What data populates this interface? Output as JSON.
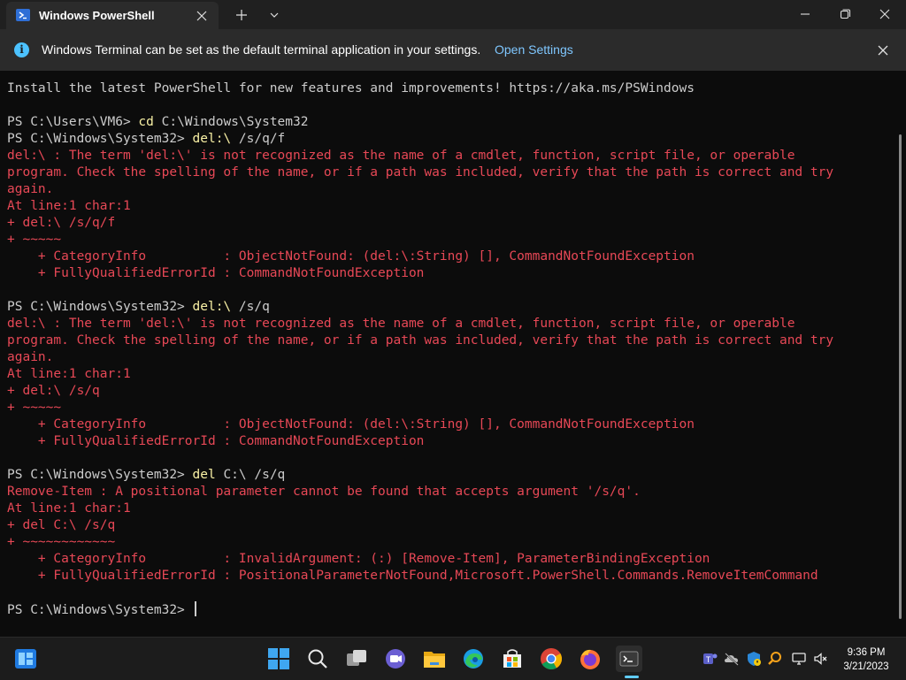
{
  "window": {
    "tab_title": "Windows PowerShell",
    "new_tab_label": "+",
    "minimize": "—",
    "maximize": "□",
    "close": "✕"
  },
  "infobar": {
    "message": "Windows Terminal can be set as the default terminal application in your settings.",
    "link": "Open Settings"
  },
  "terminal": {
    "lines": [
      [
        {
          "t": "Install the latest PowerShell for new features and improvements! https://aka.ms/PSWindows",
          "c": "w"
        }
      ],
      [],
      [
        {
          "t": "PS C:\\Users\\VM6> ",
          "c": "w"
        },
        {
          "t": "cd",
          "c": "y"
        },
        {
          "t": " C:\\Windows\\System32",
          "c": "w"
        }
      ],
      [
        {
          "t": "PS C:\\Windows\\System32> ",
          "c": "w"
        },
        {
          "t": "del:\\",
          "c": "y"
        },
        {
          "t": " /s/q/f",
          "c": "w"
        }
      ],
      [
        {
          "t": "del:\\ : The term 'del:\\' is not recognized as the name of a cmdlet, function, script file, or operable",
          "c": "e"
        }
      ],
      [
        {
          "t": "program. Check the spelling of the name, or if a path was included, verify that the path is correct and try",
          "c": "e"
        }
      ],
      [
        {
          "t": "again.",
          "c": "e"
        }
      ],
      [
        {
          "t": "At line:1 char:1",
          "c": "e"
        }
      ],
      [
        {
          "t": "+ del:\\ /s/q/f",
          "c": "e"
        }
      ],
      [
        {
          "t": "+ ~~~~~",
          "c": "e"
        }
      ],
      [
        {
          "t": "    + CategoryInfo          : ObjectNotFound: (del:\\:String) [], CommandNotFoundException",
          "c": "e"
        }
      ],
      [
        {
          "t": "    + FullyQualifiedErrorId : CommandNotFoundException",
          "c": "e"
        }
      ],
      [],
      [
        {
          "t": "PS C:\\Windows\\System32> ",
          "c": "w"
        },
        {
          "t": "del:\\",
          "c": "y"
        },
        {
          "t": " /s/q",
          "c": "w"
        }
      ],
      [
        {
          "t": "del:\\ : The term 'del:\\' is not recognized as the name of a cmdlet, function, script file, or operable",
          "c": "e"
        }
      ],
      [
        {
          "t": "program. Check the spelling of the name, or if a path was included, verify that the path is correct and try",
          "c": "e"
        }
      ],
      [
        {
          "t": "again.",
          "c": "e"
        }
      ],
      [
        {
          "t": "At line:1 char:1",
          "c": "e"
        }
      ],
      [
        {
          "t": "+ del:\\ /s/q",
          "c": "e"
        }
      ],
      [
        {
          "t": "+ ~~~~~",
          "c": "e"
        }
      ],
      [
        {
          "t": "    + CategoryInfo          : ObjectNotFound: (del:\\:String) [], CommandNotFoundException",
          "c": "e"
        }
      ],
      [
        {
          "t": "    + FullyQualifiedErrorId : CommandNotFoundException",
          "c": "e"
        }
      ],
      [],
      [
        {
          "t": "PS C:\\Windows\\System32> ",
          "c": "w"
        },
        {
          "t": "del",
          "c": "y"
        },
        {
          "t": " C:\\ /s/q",
          "c": "w"
        }
      ],
      [
        {
          "t": "Remove-Item : A positional parameter cannot be found that accepts argument '/s/q'.",
          "c": "e"
        }
      ],
      [
        {
          "t": "At line:1 char:1",
          "c": "e"
        }
      ],
      [
        {
          "t": "+ del C:\\ /s/q",
          "c": "e"
        }
      ],
      [
        {
          "t": "+ ~~~~~~~~~~~~",
          "c": "e"
        }
      ],
      [
        {
          "t": "    + CategoryInfo          : InvalidArgument: (:) [Remove-Item], ParameterBindingException",
          "c": "e"
        }
      ],
      [
        {
          "t": "    + FullyQualifiedErrorId : PositionalParameterNotFound,Microsoft.PowerShell.Commands.RemoveItemCommand",
          "c": "e"
        }
      ],
      [],
      [
        {
          "t": "PS C:\\Windows\\System32> ",
          "c": "w"
        }
      ]
    ]
  },
  "taskbar": {
    "time": "9:36 PM",
    "date": "3/21/2023",
    "apps": [
      "widgets-icon",
      "start-icon",
      "search-icon",
      "task-view-icon",
      "teams-chat-icon",
      "file-explorer-icon",
      "edge-icon",
      "microsoft-store-icon",
      "chrome-icon",
      "firefox-icon",
      "terminal-icon"
    ],
    "tray": [
      "teams-tray-icon",
      "onedrive-icon",
      "security-icon",
      "search-tray-icon",
      "network-icon",
      "volume-muted-icon"
    ]
  },
  "colors": {
    "prompt": "#cccccc",
    "command": "#f9f1a5",
    "error": "#e74856",
    "link": "#7fc7ff",
    "accent": "#60cdff"
  }
}
